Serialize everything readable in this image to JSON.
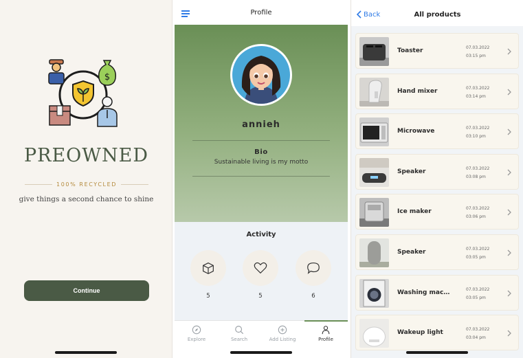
{
  "splash": {
    "brand": "PREOWNED",
    "tagline": "100% RECYCLED",
    "motto": "give things a second chance to shine",
    "continue_label": "Continue",
    "colors": {
      "accent": "#4a5a45",
      "tag": "#b48a3c",
      "background": "#f7f4ef"
    }
  },
  "profile": {
    "nav_title": "Profile",
    "username": "annieh",
    "bio_heading": "Bio",
    "bio_text": "Sustainable living is my motto",
    "activity_heading": "Activity",
    "activity": [
      {
        "icon": "box-icon",
        "count": "5"
      },
      {
        "icon": "heart-icon",
        "count": "5"
      },
      {
        "icon": "chat-bubble-icon",
        "count": "6"
      }
    ],
    "tabs": [
      {
        "label": "Explore",
        "icon": "compass-icon"
      },
      {
        "label": "Search",
        "icon": "search-icon"
      },
      {
        "label": "Add Listing",
        "icon": "plus-circle-icon"
      },
      {
        "label": "Profile",
        "icon": "person-icon",
        "active": true
      }
    ]
  },
  "products": {
    "back_label": "Back",
    "nav_title": "All products",
    "items": [
      {
        "name": "Toaster",
        "date": "07.03.2022",
        "time": "03:15 pm"
      },
      {
        "name": "Hand mixer",
        "date": "07.03.2022",
        "time": "03:14 pm"
      },
      {
        "name": "Microwave",
        "date": "07.03.2022",
        "time": "03:10 pm"
      },
      {
        "name": "Speaker",
        "date": "07.03.2022",
        "time": "03:08 pm"
      },
      {
        "name": "Ice maker",
        "date": "07.03.2022",
        "time": "03:06 pm"
      },
      {
        "name": "Speaker",
        "date": "07.03.2022",
        "time": "03:05 pm"
      },
      {
        "name": "Washing machi...",
        "date": "07.03.2022",
        "time": "03:05 pm"
      },
      {
        "name": "Wakeup light",
        "date": "07.03.2022",
        "time": "03:04 pm"
      }
    ]
  }
}
